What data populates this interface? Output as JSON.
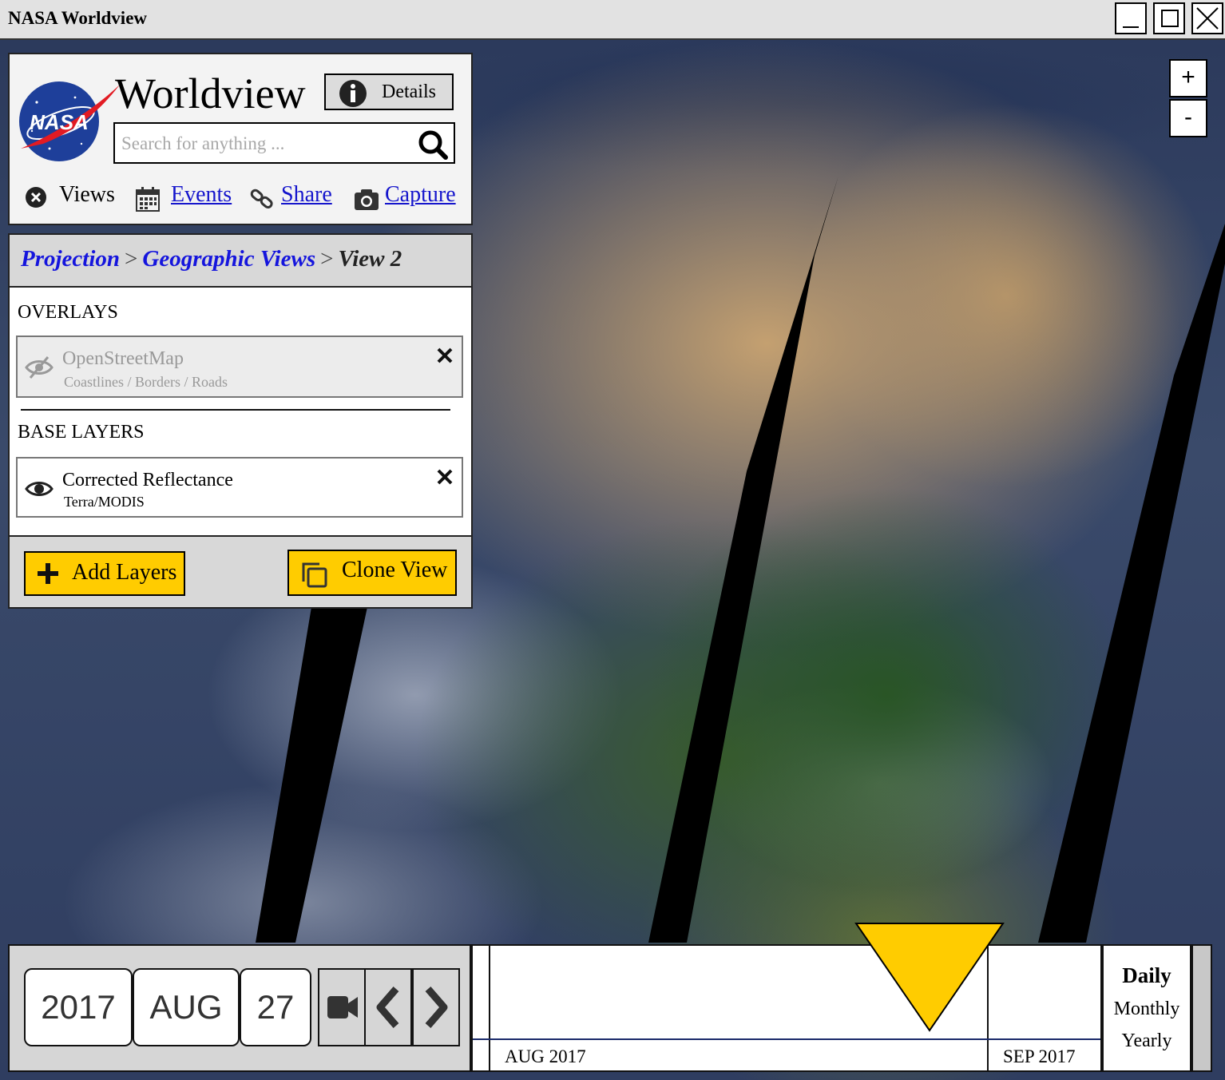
{
  "window": {
    "title": "NASA Worldview",
    "controls": [
      "minimize",
      "maximize",
      "close"
    ]
  },
  "header": {
    "logo_text": "NASA",
    "app_title": "Worldview",
    "details_label": "Details",
    "search_placeholder": "Search for anything ...",
    "nav": {
      "views_label": "Views",
      "events_label": "Events",
      "share_label": "Share",
      "capture_label": "Capture"
    }
  },
  "breadcrumb": {
    "items": [
      "Projection",
      "Geographic Views",
      "View 2"
    ],
    "separator": ">"
  },
  "layers": {
    "overlays_heading": "OVERLAYS",
    "overlays": [
      {
        "name": "OpenStreetMap",
        "subtitle": "Coastlines / Borders / Roads",
        "visible": false
      }
    ],
    "base_heading": "BASE LAYERS",
    "base": [
      {
        "name": "Corrected Reflectance",
        "subtitle": "Terra/MODIS",
        "visible": true
      }
    ],
    "add_layers_label": "Add Layers",
    "clone_view_label": "Clone View"
  },
  "map": {
    "zoom_in_label": "+",
    "zoom_out_label": "-"
  },
  "timeline": {
    "year": "2017",
    "month": "AUG",
    "day": "27",
    "months": [
      "AUG 2017",
      "SEP 2017"
    ],
    "scales": [
      "Daily",
      "Monthly",
      "Yearly"
    ],
    "selected_scale": "Daily"
  },
  "colors": {
    "accent_yellow": "#ffcc00",
    "link_blue": "#1515cc",
    "panel_grey": "#d8d8d8"
  }
}
